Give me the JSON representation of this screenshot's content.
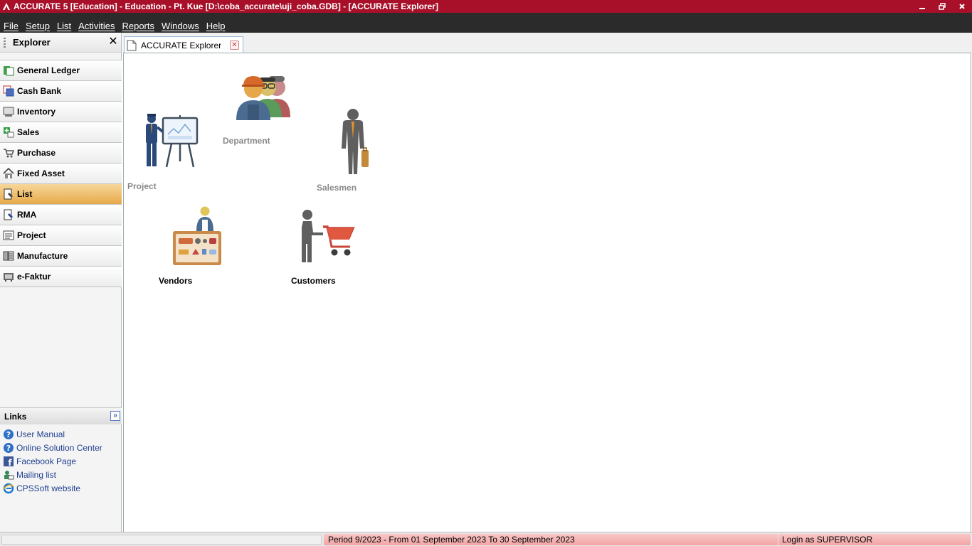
{
  "window": {
    "title": "ACCURATE 5 [Education] - Education - Pt. Kue   [D:\\coba_accurate\\uji_coba.GDB] - [ACCURATE Explorer]",
    "title_color": "#a8102a"
  },
  "menu": {
    "items": [
      "File",
      "Setup",
      "List",
      "Activities",
      "Reports",
      "Windows",
      "Help"
    ]
  },
  "explorer": {
    "title": "Explorer",
    "close_icon": "close-icon",
    "items": [
      {
        "label": "General Ledger",
        "icon": "ledger-icon"
      },
      {
        "label": "Cash Bank",
        "icon": "cash-bank-icon"
      },
      {
        "label": "Inventory",
        "icon": "inventory-icon"
      },
      {
        "label": "Sales",
        "icon": "sales-icon"
      },
      {
        "label": "Purchase",
        "icon": "cart-icon"
      },
      {
        "label": "Fixed Asset",
        "icon": "house-icon"
      },
      {
        "label": "List",
        "icon": "list-icon",
        "active": true
      },
      {
        "label": "RMA",
        "icon": "rma-icon"
      },
      {
        "label": "Project",
        "icon": "project-icon"
      },
      {
        "label": "Manufacture",
        "icon": "manufacture-icon"
      },
      {
        "label": "e-Faktur",
        "icon": "efaktur-icon"
      }
    ],
    "active_color": "#e7a94a"
  },
  "links": {
    "title": "Links",
    "items": [
      {
        "label": "User Manual",
        "icon": "help-icon"
      },
      {
        "label": "Online Solution Center",
        "icon": "help-icon"
      },
      {
        "label": "Facebook Page",
        "icon": "facebook-icon"
      },
      {
        "label": "Mailing list",
        "icon": "mailing-list-icon"
      },
      {
        "label": "CPSSoft website",
        "icon": "ie-icon"
      }
    ]
  },
  "tab": {
    "label": "ACCURATE Explorer"
  },
  "content": {
    "items": {
      "project": {
        "label": "Project",
        "state": "disabled"
      },
      "department": {
        "label": "Department",
        "state": "disabled"
      },
      "salesmen": {
        "label": "Salesmen",
        "state": "disabled"
      },
      "vendors": {
        "label": "Vendors",
        "state": "enabled"
      },
      "customers": {
        "label": "Customers",
        "state": "enabled"
      }
    }
  },
  "status": {
    "period": "Period 9/2023 - From 01 September 2023 To 30 September 2023",
    "login": "Login as SUPERVISOR"
  }
}
